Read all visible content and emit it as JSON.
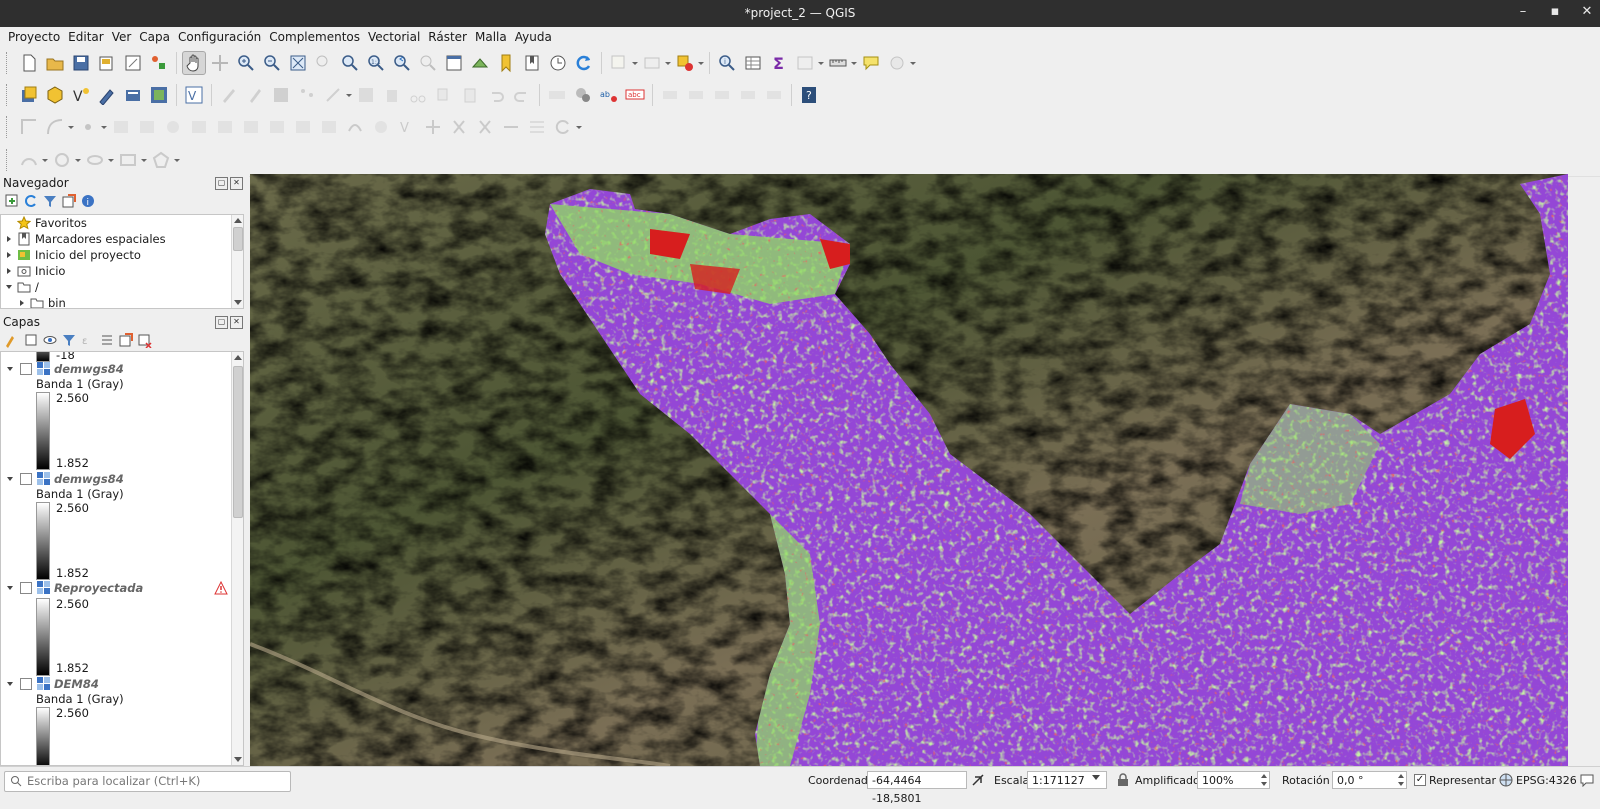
{
  "window": {
    "title": "*project_2 — QGIS",
    "minimize": "–",
    "maximize": "▪",
    "close": "✕"
  },
  "menu": [
    "Proyecto",
    "Editar",
    "Ver",
    "Capa",
    "Configuración",
    "Complementos",
    "Vectorial",
    "Ráster",
    "Malla",
    "Ayuda"
  ],
  "navigator": {
    "title": "Navegador",
    "items": [
      "Favoritos",
      "Marcadores espaciales",
      "Inicio del proyecto",
      "Inicio",
      "/",
      "bin"
    ]
  },
  "layers_panel": {
    "title": "Capas",
    "top_value": "-18",
    "layers": [
      {
        "name": "demwgs84",
        "band": "Banda 1 (Gray)",
        "max": "2.560",
        "min": "1.852"
      },
      {
        "name": "demwgs84",
        "band": "Banda 1 (Gray)",
        "max": "2.560",
        "min": "1.852"
      },
      {
        "name": "Reproyectada",
        "band": "",
        "max": "2.560",
        "min": "1.852"
      },
      {
        "name": "DEM84",
        "band": "Banda 1 (Gray)",
        "max": "2.560",
        "min": ""
      }
    ]
  },
  "statusbar": {
    "locator_placeholder": "Escriba para localizar (Ctrl+K)",
    "coord_label": "Coordenada",
    "coord_value": "-64,4464 -18,5801",
    "scale_label": "Escala",
    "scale_value": "1:171127",
    "magnifier_label": "Amplificador",
    "magnifier_value": "100%",
    "rotation_label": "Rotación",
    "rotation_value": "0,0 °",
    "render_label": "Representar",
    "crs": "EPSG:4326"
  },
  "colors": {
    "purple": "#9447d6",
    "green": "#8fe05e",
    "red": "#d71e1e",
    "terrain": "#5b5f3d"
  }
}
